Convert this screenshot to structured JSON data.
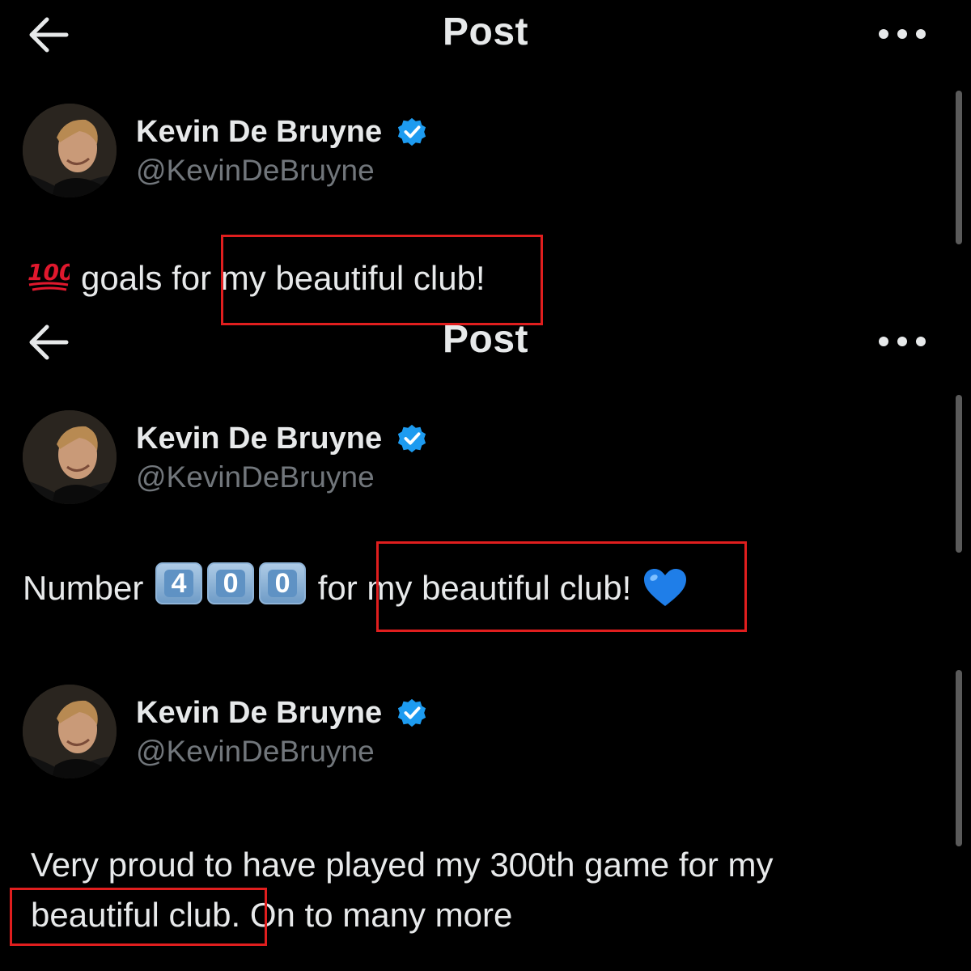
{
  "screens": [
    {
      "header": {
        "title": "Post"
      },
      "author": {
        "name": "Kevin De Bruyne",
        "handle": "@KevinDeBruyne"
      },
      "post": {
        "emoji": "💯",
        "prefix": "goals for",
        "highlight": "my beautiful club!"
      }
    },
    {
      "header": {
        "title": "Post"
      },
      "author": {
        "name": "Kevin De Bruyne",
        "handle": "@KevinDeBruyne"
      },
      "post": {
        "prefix": "Number",
        "keycaps": [
          "4",
          "0",
          "0"
        ],
        "middle": "for",
        "highlight": "my beautiful club!",
        "emoji": "💙"
      }
    },
    {
      "author": {
        "name": "Kevin De Bruyne",
        "handle": "@KevinDeBruyne"
      },
      "post": {
        "line1": "Very proud to have played my 300th game for my",
        "highlight": "beautiful club.",
        "suffix": "On to many more"
      }
    }
  ],
  "colors": {
    "background": "#000000",
    "text": "#e7e9ea",
    "secondary_text": "#71767b",
    "verified": "#1d9bf0",
    "highlight_box": "#e01e1e"
  },
  "icons": {
    "back": "arrow-left-icon",
    "more": "more-horizontal-icon",
    "verified": "verified-badge-icon"
  }
}
